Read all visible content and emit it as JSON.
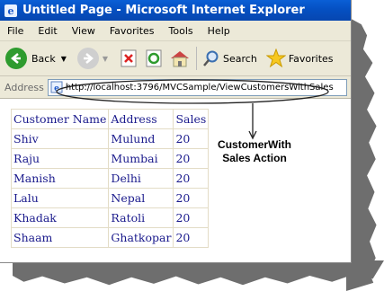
{
  "window": {
    "title": "Untitled Page - Microsoft Internet Explorer"
  },
  "menu": [
    "File",
    "Edit",
    "View",
    "Favorites",
    "Tools",
    "Help"
  ],
  "toolbar": {
    "back_label": "Back",
    "search_label": "Search",
    "favorites_label": "Favorites"
  },
  "address": {
    "label": "Address",
    "url": "http://localhost:3796/MVCSample/ViewCustomersWithSales"
  },
  "table": {
    "headers": [
      "Customer Name",
      "Address",
      "Sales"
    ],
    "rows": [
      [
        "Shiv",
        "Mulund",
        "20"
      ],
      [
        "Raju",
        "Mumbai",
        "20"
      ],
      [
        "Manish",
        "Delhi",
        "20"
      ],
      [
        "Lalu",
        "Nepal",
        "20"
      ],
      [
        "Khadak",
        "Ratoli",
        "20"
      ],
      [
        "Shaam",
        "Ghatkopar",
        "20"
      ]
    ]
  },
  "annotation": {
    "line1": "CustomerWith",
    "line2": "Sales Action"
  }
}
